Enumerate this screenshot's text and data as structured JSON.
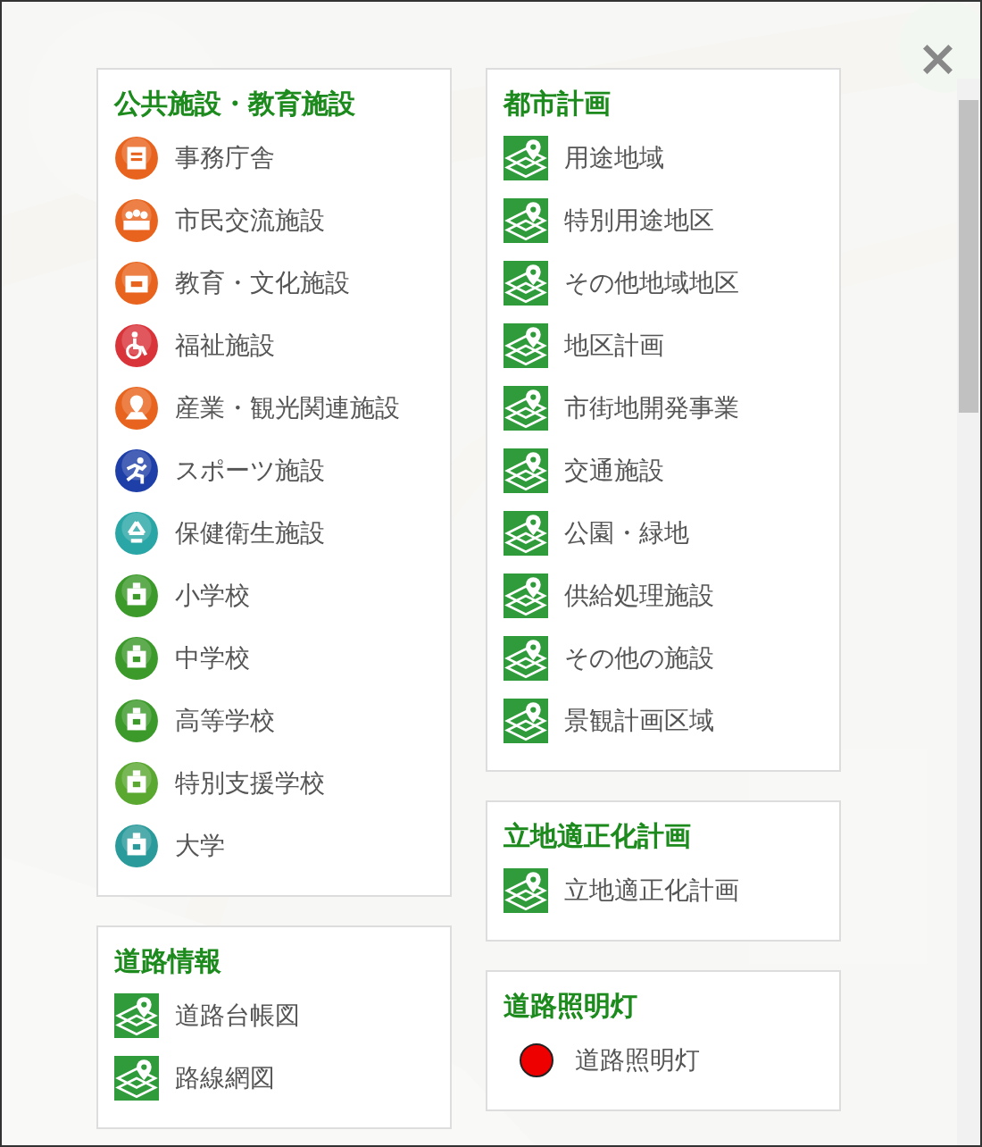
{
  "columns": [
    [
      {
        "title": "公共施設・教育施設",
        "items": [
          {
            "label": "事務庁舎",
            "kind": "office",
            "color": "#e8641e"
          },
          {
            "label": "市民交流施設",
            "kind": "people",
            "color": "#e8641e"
          },
          {
            "label": "教育・文化施設",
            "kind": "building",
            "color": "#e8641e"
          },
          {
            "label": "福祉施設",
            "kind": "wheelchair",
            "color": "#d9343a"
          },
          {
            "label": "産業・観光関連施設",
            "kind": "pin",
            "color": "#e8641e"
          },
          {
            "label": "スポーツ施設",
            "kind": "runner",
            "color": "#1f3fa8"
          },
          {
            "label": "保健衛生施設",
            "kind": "recycle",
            "color": "#2aa6a6"
          },
          {
            "label": "小学校",
            "kind": "school",
            "color": "#3c9a2a"
          },
          {
            "label": "中学校",
            "kind": "school",
            "color": "#3c9a2a"
          },
          {
            "label": "高等学校",
            "kind": "school",
            "color": "#3c9a2a"
          },
          {
            "label": "特別支援学校",
            "kind": "school",
            "color": "#5aa830"
          },
          {
            "label": "大学",
            "kind": "school",
            "color": "#2a9a9a"
          }
        ]
      },
      {
        "title": "道路情報",
        "items": [
          {
            "label": "道路台帳図",
            "kind": "map"
          },
          {
            "label": "路線網図",
            "kind": "map"
          }
        ]
      }
    ],
    [
      {
        "title": "都市計画",
        "items": [
          {
            "label": "用途地域",
            "kind": "map"
          },
          {
            "label": "特別用途地区",
            "kind": "map"
          },
          {
            "label": "その他地域地区",
            "kind": "map"
          },
          {
            "label": "地区計画",
            "kind": "map"
          },
          {
            "label": "市街地開発事業",
            "kind": "map"
          },
          {
            "label": "交通施設",
            "kind": "map"
          },
          {
            "label": "公園・緑地",
            "kind": "map"
          },
          {
            "label": "供給処理施設",
            "kind": "map"
          },
          {
            "label": "その他の施設",
            "kind": "map"
          },
          {
            "label": "景観計画区域",
            "kind": "map"
          }
        ]
      },
      {
        "title": "立地適正化計画",
        "items": [
          {
            "label": "立地適正化計画",
            "kind": "map"
          }
        ]
      },
      {
        "title": "道路照明灯",
        "items": [
          {
            "label": "道路照明灯",
            "kind": "dot",
            "color": "#ee0000"
          }
        ]
      }
    ]
  ],
  "close": "×"
}
